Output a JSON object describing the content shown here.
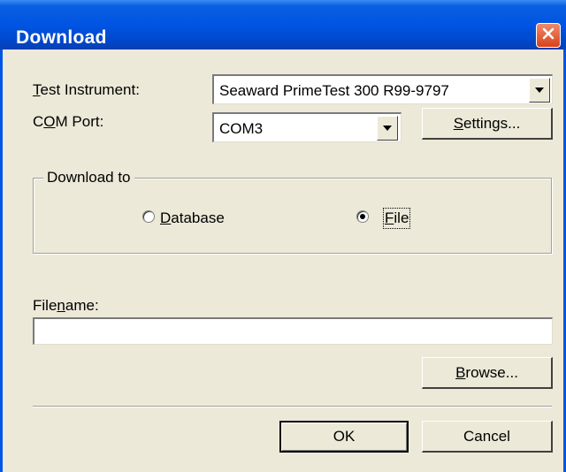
{
  "window": {
    "title": "Download"
  },
  "labels": {
    "test_instrument": {
      "pre": "",
      "u": "T",
      "post": "est Instrument:"
    },
    "com_port": {
      "pre": "C",
      "u": "O",
      "post": "M Port:"
    },
    "download_to": "Download to",
    "filename": {
      "pre": "File",
      "u": "n",
      "post": "ame:"
    }
  },
  "test_instrument_select": {
    "value": "Seaward PrimeTest 300 R99-9797"
  },
  "com_port_select": {
    "value": "COM3"
  },
  "buttons": {
    "settings": {
      "pre": "",
      "u": "S",
      "post": "ettings..."
    },
    "browse": {
      "pre": "",
      "u": "B",
      "post": "rowse..."
    },
    "ok": "OK",
    "cancel": "Cancel"
  },
  "radios": {
    "database": {
      "pre": "",
      "u": "D",
      "post": "atabase",
      "selected": false
    },
    "file": {
      "pre": "",
      "u": "F",
      "post": "ile",
      "selected": true
    }
  },
  "filename_input": {
    "value": ""
  },
  "icons": {
    "close": "close-icon",
    "dropdown": "chevron-down-icon"
  },
  "colors": {
    "titlebar": "#0054E3",
    "close": "#D9421A",
    "dialog_bg": "#ECE9D8"
  }
}
